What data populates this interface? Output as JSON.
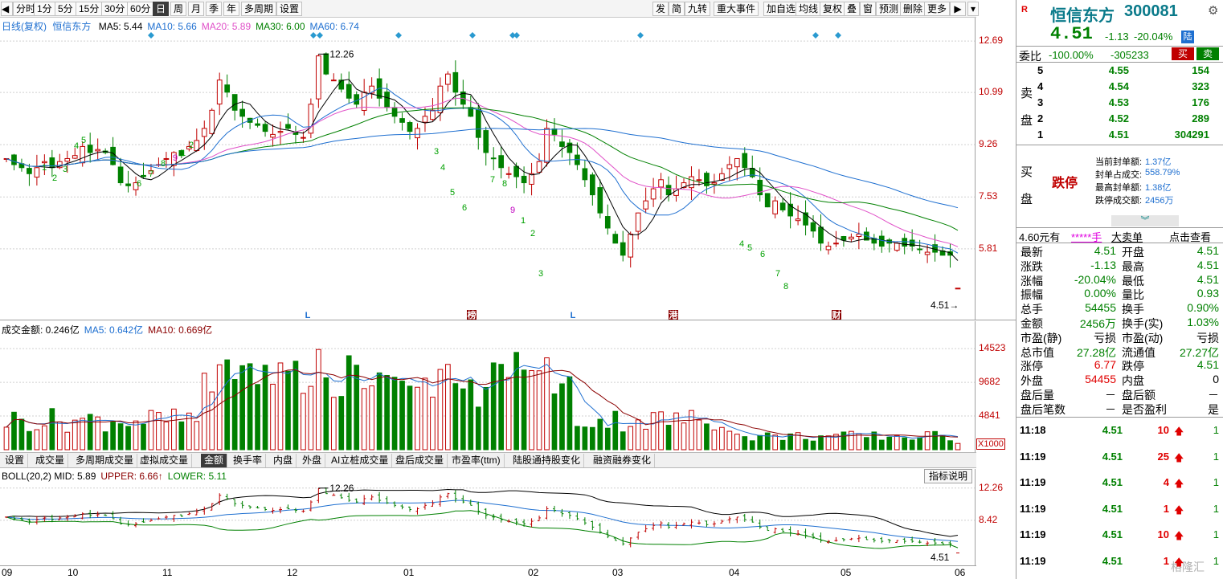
{
  "toolbar": {
    "left": [
      "分时",
      "1分",
      "5分",
      "15分",
      "30分",
      "60分",
      "日",
      "周",
      "月",
      "季",
      "年",
      "多周期",
      "设置"
    ],
    "active": "日",
    "right": [
      "发",
      "简",
      "九转",
      "重大事件",
      "加自选",
      "均线",
      "复权",
      "叠",
      "窗",
      "预测",
      "删除",
      "更多"
    ]
  },
  "main_chart": {
    "legend_title": "日线(复权)",
    "stock": "恒信东方",
    "ma": [
      {
        "label": "MA5: 5.44",
        "color": "#000000"
      },
      {
        "label": "MA10: 5.66",
        "color": "#1e6fd0"
      },
      {
        "label": "MA20: 5.89",
        "color": "#e050c8"
      },
      {
        "label": "MA30: 6.00",
        "color": "#008000"
      },
      {
        "label": "MA60: 6.74",
        "color": "#1e6fd0"
      }
    ],
    "yticks": [
      "12.69",
      "10.99",
      "9.26",
      "7.53",
      "5.81"
    ],
    "high_label": "12.26",
    "low_label": "4.51",
    "markers": [
      "L",
      "榜",
      "L",
      "港",
      "财"
    ]
  },
  "volume_chart": {
    "legend": [
      {
        "label": "成交金额: 0.246亿",
        "color": "#000000"
      },
      {
        "label": "MA5: 0.642亿",
        "color": "#1e6fd0"
      },
      {
        "label": "MA10: 0.669亿",
        "color": "#8b0000"
      }
    ],
    "yticks": [
      "14523",
      "9682",
      "4841"
    ],
    "unit": "X1000"
  },
  "indicator_tabs": [
    "设置",
    "成交量",
    "多周期成交量",
    "虚拟成交量",
    "金额",
    "换手率",
    "内盘",
    "外盘",
    "AI立桩成交量",
    "盘后成交量",
    "市盈率(ttm)",
    "陆股通持股变化",
    "融资融券变化"
  ],
  "indicator_active": "金额",
  "boll_chart": {
    "legend": [
      {
        "label": "BOLL(20,2) MID: 5.89",
        "color": "#000000"
      },
      {
        "label": "UPPER: 6.66↑",
        "color": "#8b0000"
      },
      {
        "label": "LOWER: 5.11",
        "color": "#008000"
      }
    ],
    "help_button": "指标说明",
    "yticks": [
      "12.26",
      "8.42"
    ],
    "high_label": "12.26",
    "low_label": "4.51"
  },
  "x_axis": [
    "09",
    "10",
    "11",
    "12",
    "01",
    "02",
    "03",
    "04",
    "05",
    "06"
  ],
  "panel": {
    "badge": "R",
    "name": "恒信东方",
    "code": "300081",
    "price": "4.51",
    "change": "-1.13",
    "change_pct": "-20.04%",
    "market": "陆",
    "weibi_label": "委比",
    "weibi_pct": "-100.00%",
    "weibi_diff": "-305233",
    "buy_btn": "买",
    "sell_btn": "卖",
    "sell_side_label": "卖盘",
    "asks": [
      {
        "lvl": "5",
        "price": "4.55",
        "vol": "154"
      },
      {
        "lvl": "4",
        "price": "4.54",
        "vol": "323"
      },
      {
        "lvl": "3",
        "price": "4.53",
        "vol": "176"
      },
      {
        "lvl": "2",
        "price": "4.52",
        "vol": "289"
      },
      {
        "lvl": "1",
        "price": "4.51",
        "vol": "304291"
      }
    ],
    "buy_side_label": "买盘",
    "limit_down": "跌停",
    "seal_info": [
      {
        "k": "当前封单额:",
        "v": "1.37亿"
      },
      {
        "k": "封单占成交:",
        "v": "558.79%"
      },
      {
        "k": "最高封单额:",
        "v": "1.38亿"
      },
      {
        "k": "跌停成交额:",
        "v": "2456万"
      }
    ],
    "big_order": {
      "price": "4.60元有",
      "vol": "*****手",
      "label": "大卖单",
      "link": "点击查看"
    },
    "stats": [
      {
        "k1": "最新",
        "v1": "4.51",
        "c1": "green",
        "k2": "开盘",
        "v2": "4.51",
        "c2": "green"
      },
      {
        "k1": "涨跌",
        "v1": "-1.13",
        "c1": "green",
        "k2": "最高",
        "v2": "4.51",
        "c2": "green"
      },
      {
        "k1": "涨幅",
        "v1": "-20.04%",
        "c1": "green",
        "k2": "最低",
        "v2": "4.51",
        "c2": "green"
      },
      {
        "k1": "振幅",
        "v1": "0.00%",
        "c1": "green",
        "k2": "量比",
        "v2": "0.93",
        "c2": "green"
      },
      {
        "k1": "总手",
        "v1": "54455",
        "c1": "green",
        "k2": "换手",
        "v2": "0.90%",
        "c2": "green"
      },
      {
        "k1": "金额",
        "v1": "2456万",
        "c1": "green",
        "k2": "换手(实)",
        "v2": "1.03%",
        "c2": "green"
      },
      {
        "k1": "市盈(静)",
        "v1": "亏损",
        "c1": "black",
        "k2": "市盈(动)",
        "v2": "亏损",
        "c2": "black"
      },
      {
        "k1": "总市值",
        "v1": "27.28亿",
        "c1": "green",
        "k2": "流通值",
        "v2": "27.27亿",
        "c2": "green"
      },
      {
        "k1": "涨停",
        "v1": "6.77",
        "c1": "red",
        "k2": "跌停",
        "v2": "4.51",
        "c2": "green"
      },
      {
        "k1": "外盘",
        "v1": "54455",
        "c1": "red",
        "k2": "内盘",
        "v2": "0",
        "c2": "black"
      },
      {
        "k1": "盘后量",
        "v1": "－",
        "c1": "black",
        "k2": "盘后额",
        "v2": "－",
        "c2": "black"
      },
      {
        "k1": "盘后笔数",
        "v1": "－",
        "c1": "black",
        "k2": "是否盈利",
        "v2": "是",
        "c2": "black"
      }
    ],
    "ticks": [
      {
        "t": "11:18",
        "p": "4.51",
        "v": "10",
        "n": "1"
      },
      {
        "t": "11:19",
        "p": "4.51",
        "v": "25",
        "n": "1"
      },
      {
        "t": "11:19",
        "p": "4.51",
        "v": "4",
        "n": "1"
      },
      {
        "t": "11:19",
        "p": "4.51",
        "v": "1",
        "n": "1"
      },
      {
        "t": "11:19",
        "p": "4.51",
        "v": "10",
        "n": "1"
      },
      {
        "t": "11:19",
        "p": "4.51",
        "v": "1",
        "n": "1"
      }
    ],
    "watermark": "格隆汇"
  },
  "chart_data": {
    "type": "candlestick",
    "title": "日线(复权)",
    "ylim": [
      4.0,
      13.2
    ],
    "months": [
      "09",
      "10",
      "11",
      "12",
      "01",
      "02",
      "03",
      "04",
      "05",
      "06"
    ],
    "close": [
      8.8,
      8.6,
      8.5,
      8.3,
      8.5,
      8.7,
      8.5,
      8.7,
      8.8,
      8.9,
      9.2,
      9.0,
      9.1,
      9.0,
      8.6,
      8.0,
      7.9,
      8.0,
      8.2,
      8.4,
      8.6,
      8.8,
      9.0,
      8.9,
      9.2,
      9.4,
      9.8,
      10.4,
      11.4,
      11.0,
      10.4,
      10.2,
      10.0,
      9.9,
      9.7,
      9.6,
      9.7,
      9.8,
      9.6,
      9.5,
      10.6,
      12.2,
      11.6,
      11.4,
      11.1,
      10.8,
      10.6,
      11.0,
      11.2,
      10.8,
      10.5,
      10.2,
      10.0,
      9.7,
      9.8,
      10.2,
      10.4,
      11.2,
      11.6,
      11.0,
      10.6,
      10.2,
      9.5,
      9.0,
      8.8,
      8.5,
      8.3,
      8.2,
      8.0,
      8.3,
      8.7,
      9.8,
      9.6,
      9.2,
      9.0,
      8.6,
      8.1,
      7.6,
      7.0,
      6.5,
      6.0,
      5.6,
      6.3,
      7.0,
      7.4,
      7.8,
      8.1,
      7.6,
      7.8,
      8.0,
      8.2,
      8.1,
      7.9,
      8.0,
      8.3,
      8.6,
      8.8,
      8.5,
      8.2,
      7.6,
      7.2,
      7.4,
      7.1,
      6.9,
      6.8,
      6.6,
      6.4,
      6.0,
      5.9,
      6.0,
      6.1,
      6.2,
      6.3,
      6.1,
      6.0,
      5.9,
      6.0,
      6.0,
      5.9,
      5.9,
      5.8,
      5.7,
      5.7,
      5.6,
      5.6,
      4.51
    ]
  }
}
